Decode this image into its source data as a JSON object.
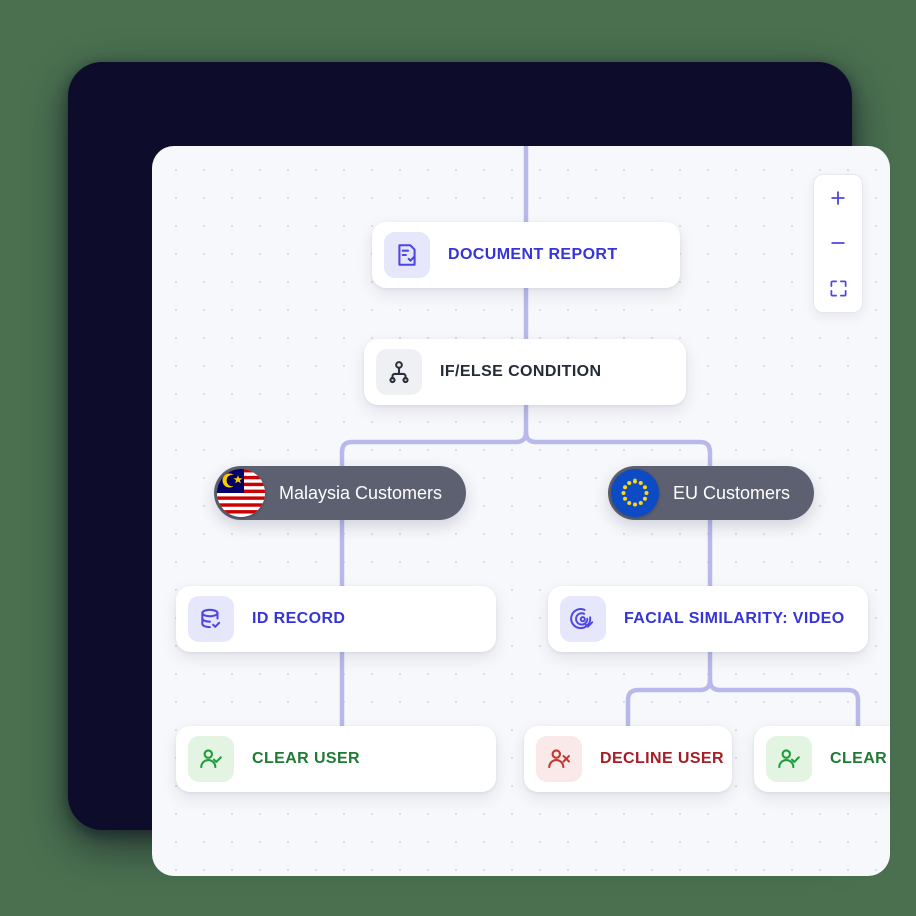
{
  "app": {
    "background_color": "#4a7050",
    "frame_color": "#0d0d2b",
    "canvas_color": "#f7f8fb",
    "accent_color": "#3634d6",
    "connector_color": "#b8b9ea"
  },
  "zoom_controls": {
    "zoom_in_label": "+",
    "zoom_out_label": "−",
    "fit_label": "fit-screen-icon"
  },
  "nodes": [
    {
      "id": "document-report",
      "label": "DOCUMENT REPORT",
      "icon": "document-check-icon",
      "icon_style": "indigo",
      "label_style": "indigo"
    },
    {
      "id": "ifelse-condition",
      "label": "IF/ELSE CONDITION",
      "icon": "branch-condition-icon",
      "icon_style": "grey",
      "label_style": "dark"
    },
    {
      "id": "id-record",
      "label": "ID RECORD",
      "icon": "database-check-icon",
      "icon_style": "indigo",
      "label_style": "indigo"
    },
    {
      "id": "facial-similarity",
      "label": "FACIAL SIMILARITY: VIDEO",
      "icon": "facial-scan-icon",
      "icon_style": "indigo",
      "label_style": "indigo"
    },
    {
      "id": "clear-user-1",
      "label": "CLEAR USER",
      "icon": "user-check-icon",
      "icon_style": "green",
      "label_style": "green"
    },
    {
      "id": "decline-user",
      "label": "DECLINE USER",
      "icon": "user-x-icon",
      "icon_style": "red",
      "label_style": "red"
    },
    {
      "id": "clear-user-2",
      "label": "CLEAR USER",
      "icon": "user-check-icon",
      "icon_style": "green",
      "label_style": "green"
    }
  ],
  "branch_pills": [
    {
      "id": "malaysia",
      "label": "Malaysia Customers",
      "flag": "malaysia-flag-icon"
    },
    {
      "id": "eu",
      "label": "EU Customers",
      "flag": "eu-flag-icon"
    }
  ]
}
